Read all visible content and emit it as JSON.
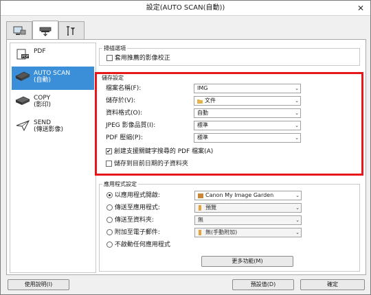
{
  "window": {
    "title": "設定(AUTO SCAN(自動))",
    "close": "✕"
  },
  "tabs": [
    {
      "name": "scan-from-computer",
      "active": false
    },
    {
      "name": "scan-from-operation-panel",
      "active": true
    },
    {
      "name": "general-settings",
      "active": false
    }
  ],
  "sidebar": {
    "items": [
      {
        "label": "PDF",
        "icon": "pdf-icon"
      },
      {
        "label": "AUTO SCAN\n(自動)",
        "icon": "scanner-icon",
        "selected": true
      },
      {
        "label": "COPY\n(影印)",
        "icon": "copy-icon"
      },
      {
        "label": "SEND\n(傳送影像)",
        "icon": "send-icon"
      }
    ]
  },
  "scan_options": {
    "title": "掃描選項",
    "apply_correction": {
      "label": "套用推薦的影像校正",
      "checked": false
    }
  },
  "save_settings": {
    "title": "儲存設定",
    "file_name": {
      "label": "檔案名稱(F):",
      "value": "IMG"
    },
    "save_in": {
      "label": "儲存於(V):",
      "value": "文件"
    },
    "data_format": {
      "label": "資料格式(O):",
      "value": "自動"
    },
    "jpeg_quality": {
      "label": "JPEG 影像品質(I):",
      "value": "標準"
    },
    "pdf_compression": {
      "label": "PDF 壓縮(P):",
      "value": "標準"
    },
    "create_searchable_pdf": {
      "label": "創建支援關鍵字搜尋的 PDF 檔案(A)",
      "checked": true
    },
    "save_to_subfolder": {
      "label": "儲存到目前日期的子資料夾",
      "checked": false
    }
  },
  "app_settings": {
    "title": "應用程式設定",
    "open_with": {
      "label": "以應用程式開啟:",
      "value": "Canon My Image Garden",
      "checked": true
    },
    "send_to_app": {
      "label": "傳送至應用程式:",
      "value": "預覽",
      "checked": false
    },
    "send_to_folder": {
      "label": "傳送至資料夾:",
      "value": "無",
      "checked": false
    },
    "attach_email": {
      "label": "附加至電子郵件:",
      "value": "無(手動附加)",
      "checked": false
    },
    "no_app": {
      "label": "不啟動任何應用程式",
      "checked": false
    },
    "more_functions": "更多功能(M)"
  },
  "footer": {
    "help": "使用說明(I)",
    "defaults": "預設值(D)",
    "ok": "確定"
  },
  "colors": {
    "highlight": "#e8151a",
    "selection": "#3a8fd8"
  }
}
